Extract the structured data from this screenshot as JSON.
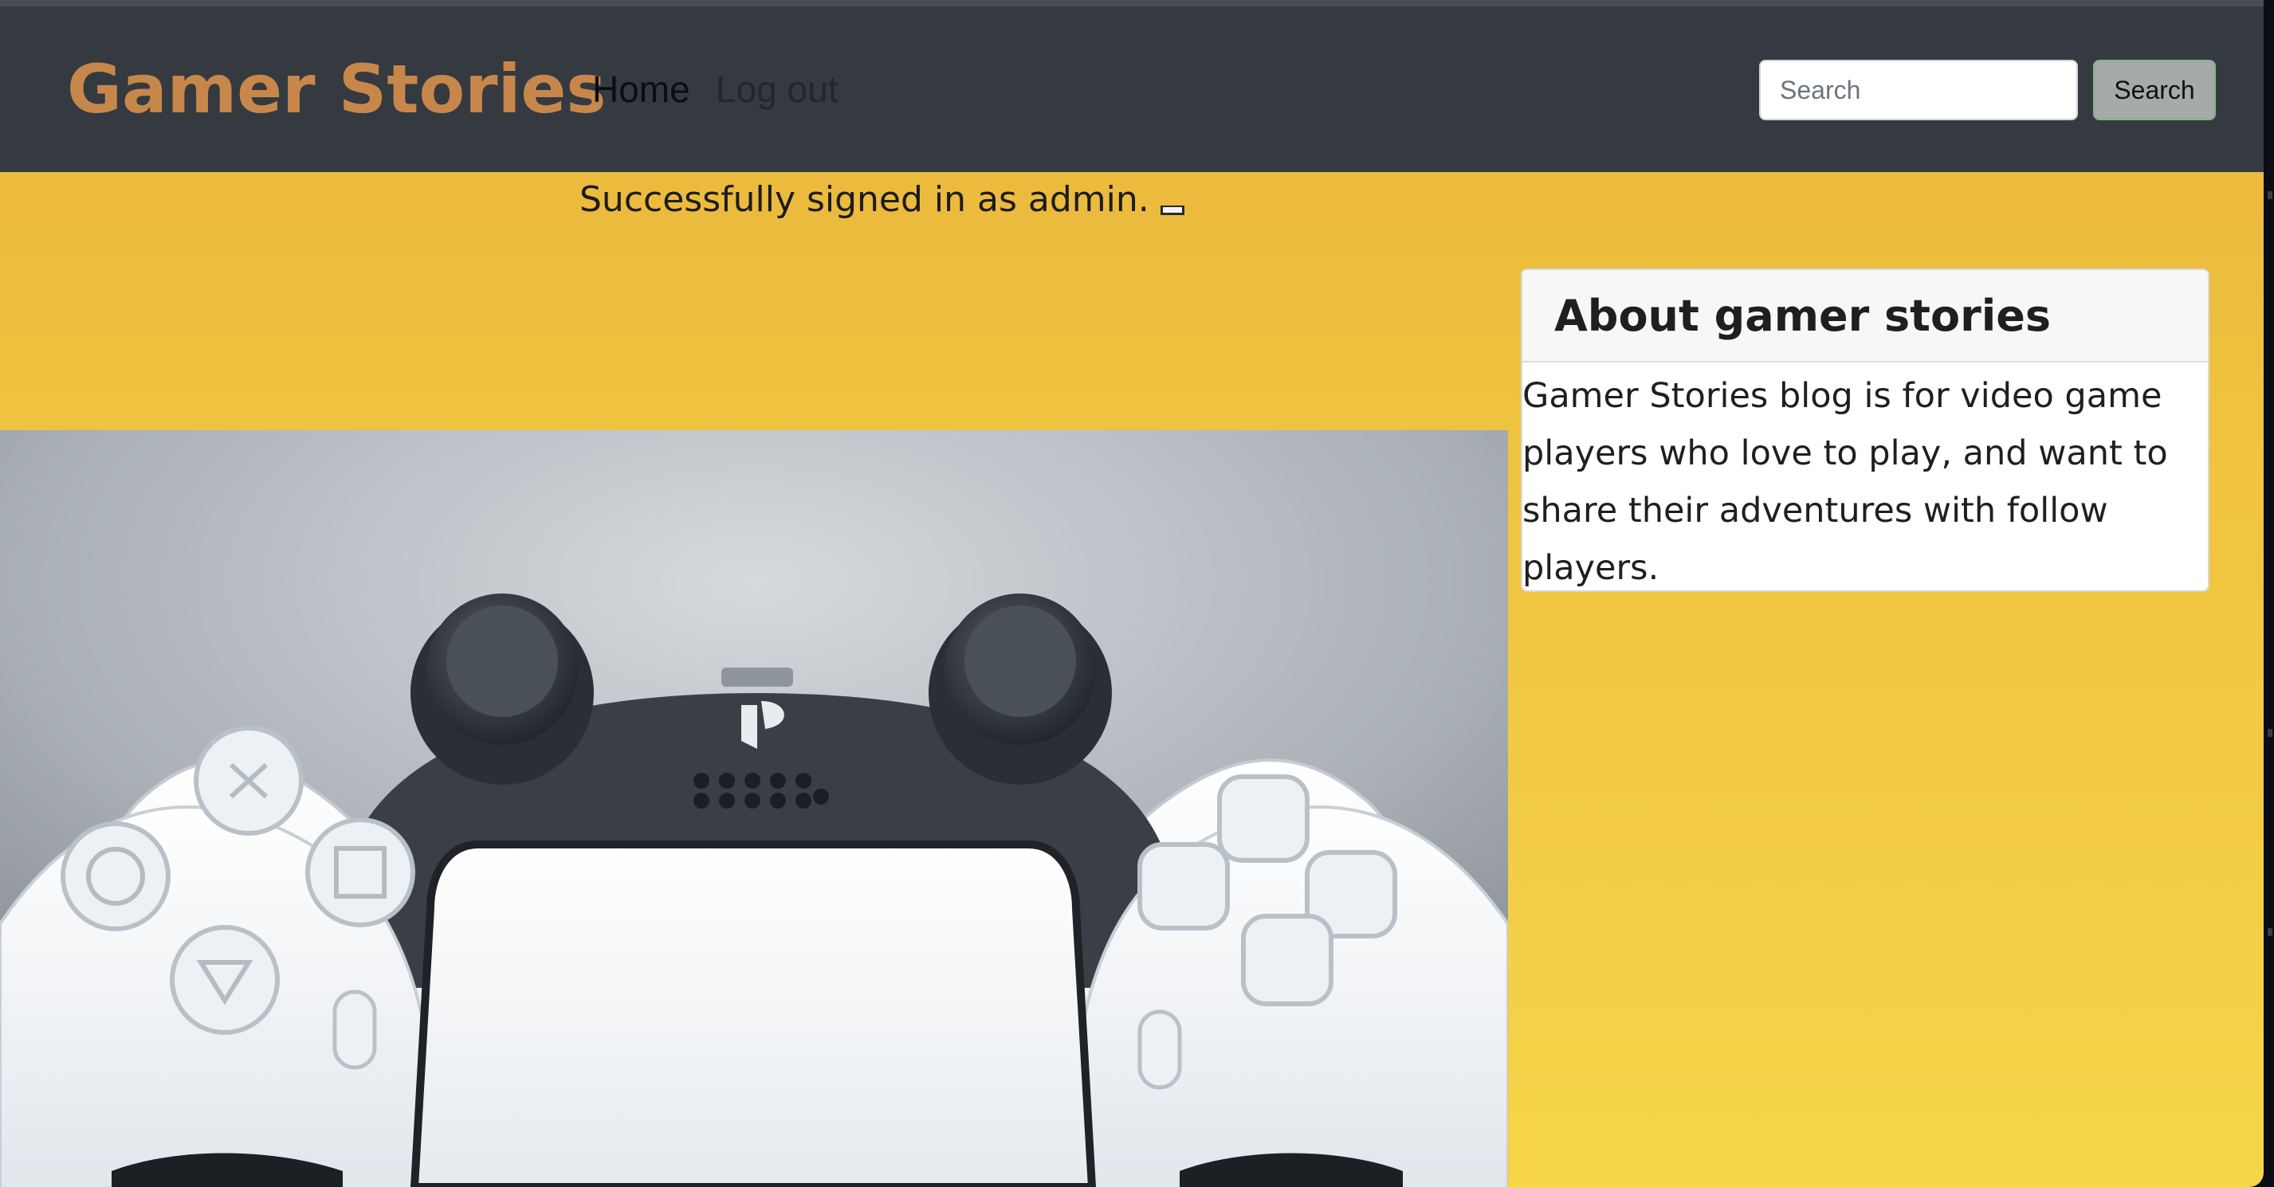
{
  "navbar": {
    "brand": "Gamer Stories",
    "links": [
      {
        "label": "Home"
      },
      {
        "label": "Log out"
      }
    ],
    "search": {
      "placeholder": "Search",
      "value": "",
      "button_label": "Search"
    }
  },
  "flash": {
    "message": "Successfully signed in as admin."
  },
  "sidebar": {
    "card_title": "About gamer stories",
    "card_body": "Gamer Stories blog is for video game players who love to play, and want to share their adventures with follow players."
  },
  "colors": {
    "navbar_bg": "#343a40",
    "brand": "#c8874a",
    "page_bg_top": "#e9b43c",
    "page_bg_bottom": "#f6d548",
    "search_button_bg": "#a6aba9"
  },
  "icons": {
    "hero_image": "game-controller-photo",
    "flash_close": "close-icon"
  }
}
